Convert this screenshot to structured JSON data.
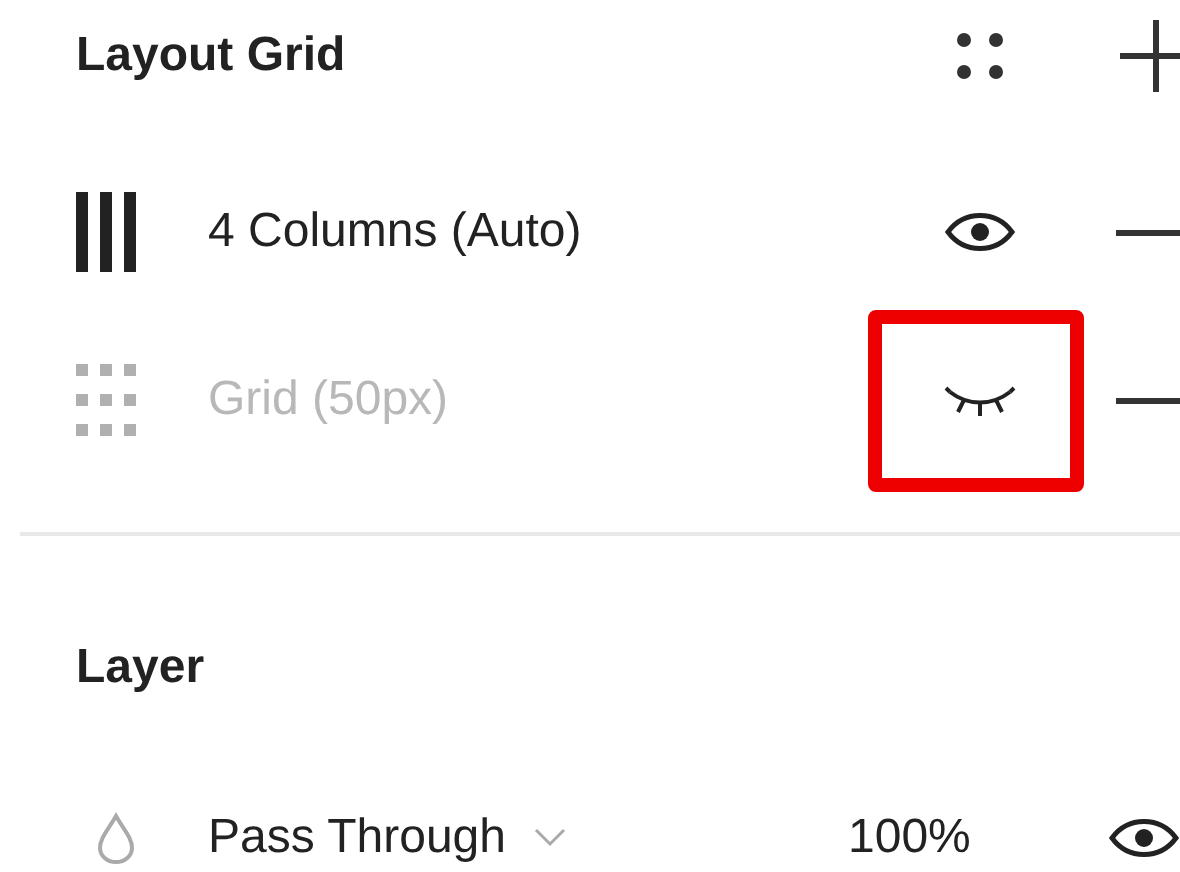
{
  "layout_grid": {
    "title": "Layout Grid",
    "grids": [
      {
        "kind": "columns",
        "label": "4 Columns (Auto)",
        "visible": true,
        "highlighted": false
      },
      {
        "kind": "grid",
        "label": "Grid (50px)",
        "visible": false,
        "highlighted": true
      }
    ]
  },
  "layer": {
    "title": "Layer",
    "blend_mode": "Pass Through",
    "opacity": "100%",
    "visible": true
  }
}
